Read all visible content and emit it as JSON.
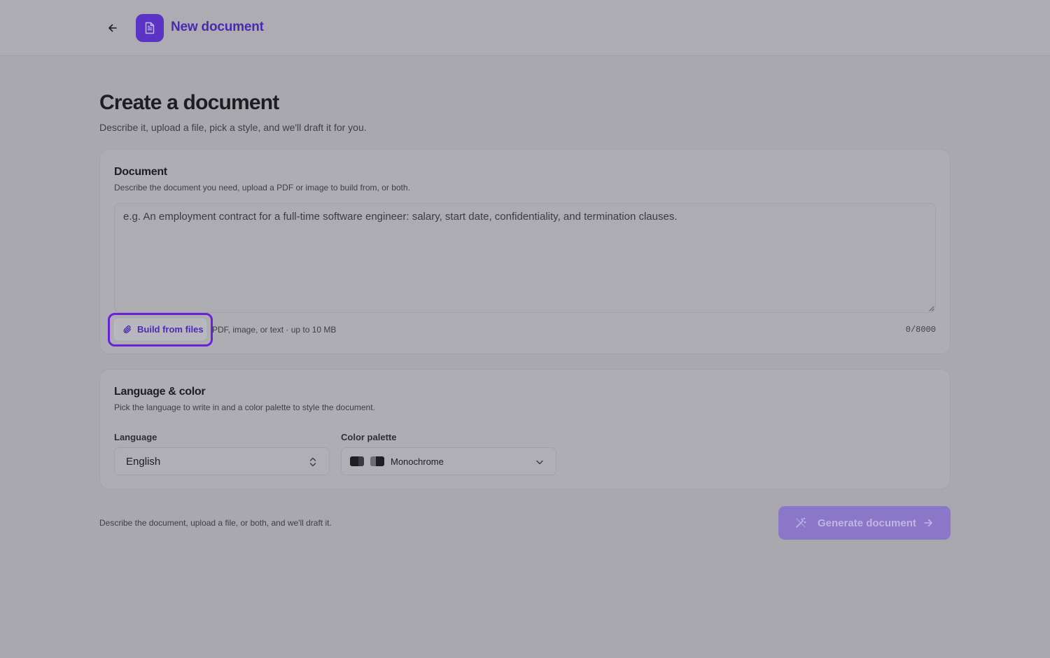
{
  "header": {
    "app_title": "New document",
    "back_icon": "arrow-left-icon",
    "app_icon": "document-icon"
  },
  "page": {
    "title": "Create a document",
    "subtitle": "Describe it, upload a file, pick a style, and we'll draft it for you."
  },
  "document_card": {
    "title": "Document",
    "description": "Describe the document you need, upload a PDF or image to build from, or both.",
    "textarea_placeholder": "e.g. An employment contract for a full-time software engineer: salary, start date, confidentiality, and termination clauses.",
    "textarea_value": "",
    "build_button_label": "Build from files",
    "file_hint": "PDF, image, or text · up to 10 MB",
    "char_count": "0/8000"
  },
  "language_card": {
    "title": "Language & color",
    "description": "Pick the language to write in and a color palette to style the document.",
    "language_label": "Language",
    "language_value": "English",
    "palette_label": "Color palette",
    "palette_value": "Monochrome"
  },
  "footer": {
    "note": "Describe the document, upload a file, or both, and we'll draft it.",
    "generate_label": "Generate document"
  },
  "colors": {
    "accent": "#5b34c6",
    "highlight_border": "#6a22d8",
    "generate_button": "#8a77c8"
  }
}
